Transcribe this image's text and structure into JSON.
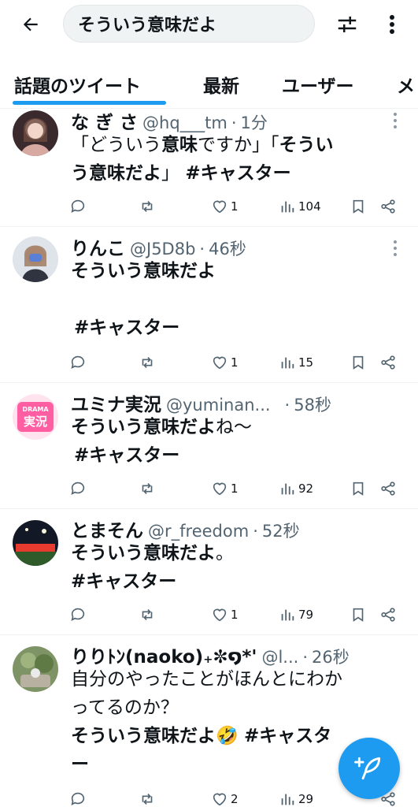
{
  "search": {
    "query": "そういう意味だよ"
  },
  "tabs": [
    {
      "label": "話題のツイート"
    },
    {
      "label": "最新"
    },
    {
      "label": "ユーザー"
    },
    {
      "label": "メ"
    }
  ],
  "tweets": [
    {
      "name": "な ぎ さ",
      "handle": "@hq___tm",
      "time": "1分",
      "text_parts": [
        "「どういう",
        "意味",
        "ですか」「",
        "そうい"
      ],
      "text_line2": [
        "う意味だよ",
        "」 ",
        "#キャスター"
      ],
      "replies": "",
      "retweets": "",
      "likes": "1",
      "views": "104",
      "avatar_color": "#b48a7c"
    },
    {
      "name": "りんこ",
      "handle": "@J5D8b",
      "time": "46秒",
      "text1": "そういう意味だよ",
      "hashtag": "#キャスター",
      "likes": "1",
      "views": "15",
      "avatar_color": "#8a8f99"
    },
    {
      "name": "ユミナ実況",
      "handle": "@yuminan...",
      "time": "58秒",
      "text_bold": "そういう意味だよ",
      "text_tail": "ね～",
      "hashtag": "#キャスター",
      "likes": "1",
      "views": "92",
      "avatar_color": "#ff5fa2",
      "avatar_top": "DRAMA",
      "avatar_main": "実況"
    },
    {
      "name": "とまそん",
      "handle": "@r_freedom",
      "time": "52秒",
      "text_bold": "そういう意味だよ",
      "text_tail": "。",
      "hashtag": "#キャスター",
      "likes": "1",
      "views": "79",
      "avatar_color": "#1b2230"
    },
    {
      "name": "りりﾄﾝ(naoko)₊✼໑*'",
      "handle": "@l...",
      "time": "26秒",
      "text1": "自分のやったことがほんとにわか",
      "text2": "ってるのか？",
      "text_bold": "そういう意味だよ",
      "emoji": "🤣",
      "hashtag": "#キャスタ",
      "hashtag_tail": "ー",
      "likes": "2",
      "views": "29",
      "avatar_color": "#6a7d55"
    }
  ],
  "colors": {
    "accent": "#1d9bf0",
    "muted": "#536471",
    "text": "#0f1419"
  }
}
